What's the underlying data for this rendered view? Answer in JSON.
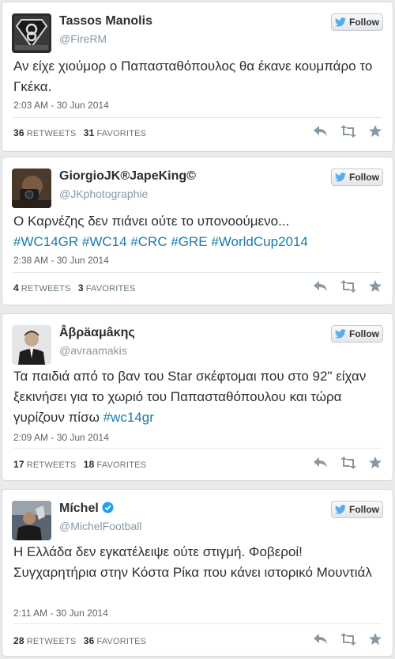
{
  "colors": {
    "link": "#1a79a8",
    "bird": "#55acee",
    "verified": "#1da1f2",
    "action_icon": "#8899a6"
  },
  "follow_label": "Follow",
  "retweets_label": "RETWEETS",
  "favorites_label": "FAVORITES",
  "icons": [
    "twitter-bird-icon",
    "reply-icon",
    "retweet-icon",
    "favorite-icon",
    "verified-badge-icon"
  ],
  "tweets": [
    {
      "name": "Tassos Manolis",
      "handle": "@FireRM",
      "verified": false,
      "text": "Αν είχε χιούμορ ο Παπασταθόπουλος θα έκανε κουμπάρο το Γκέκα.",
      "time": "2:03 AM - 30 Jun 2014",
      "retweets": "36",
      "favorites": "31"
    },
    {
      "name": "GiorgioJK®JapeKing©",
      "handle": "@JKphotographie",
      "verified": false,
      "text": "Ο Καρνέζης δεν πιάνει ούτε το υπονοούμενο...",
      "hashtags": "#WC14GR #WC14 #CRC #GRE #WorldCup2014",
      "time": "2:38 AM - 30 Jun 2014",
      "retweets": "4",
      "favorites": "3"
    },
    {
      "name": "Âβρäαμâκης",
      "handle": "@avraamakis",
      "verified": false,
      "text": "Τα παιδιά από το βαν του Star σκέφτομαι που στο 92\" είχαν ξεκινήσει για το χωριό του Παπασταθόπουλου και τώρα γυρίζουν πίσω",
      "hashtags": "#wc14gr",
      "time": "2:09 AM - 30 Jun 2014",
      "retweets": "17",
      "favorites": "18"
    },
    {
      "name": "Míchel",
      "handle": "@MichelFootball",
      "verified": true,
      "text": "Η Ελλάδα δεν εγκατέλειψε ούτε στιγμή. Φοβεροί! Συγχαρητήρια στην Κόστα Ρίκα που κάνει ιστορικό Μουντιάλ",
      "time": "2:11 AM - 30 Jun 2014",
      "retweets": "28",
      "favorites": "36"
    }
  ]
}
